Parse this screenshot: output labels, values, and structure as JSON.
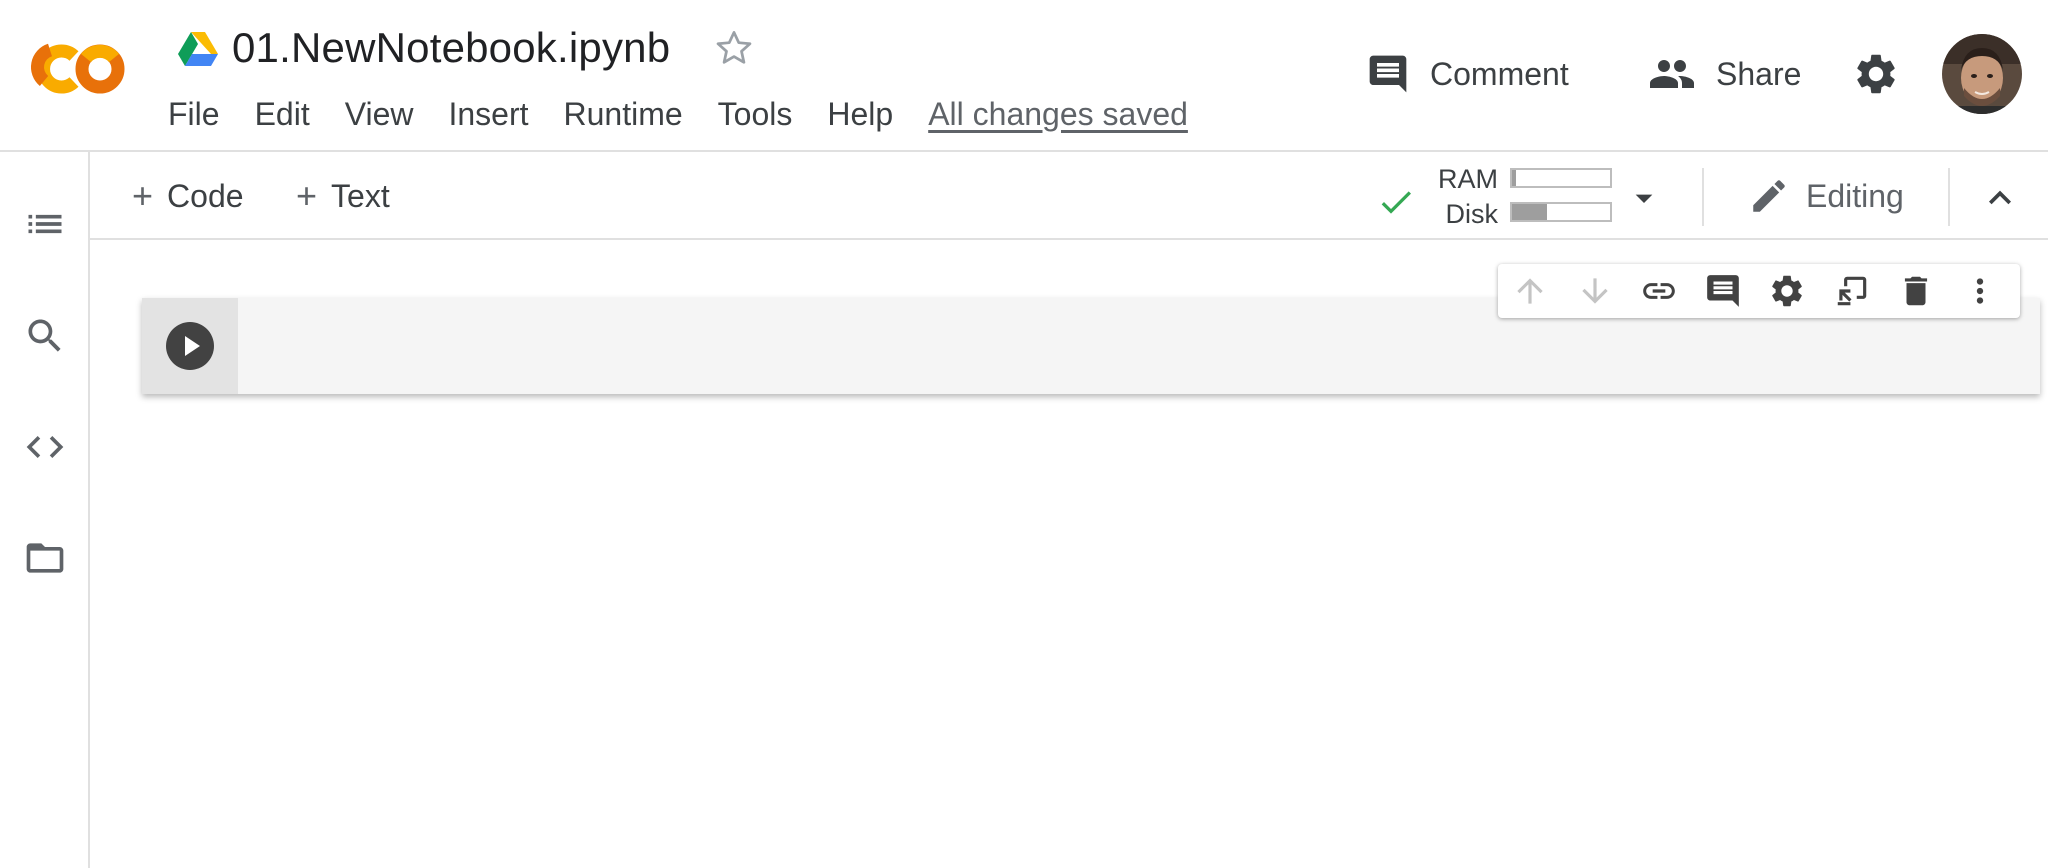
{
  "app": {
    "notebook_title": "01.NewNotebook.ipynb",
    "brand_colors": {
      "logo_orange": "#e8710a",
      "logo_yellow": "#f9ab00"
    }
  },
  "menu": {
    "items": [
      "File",
      "Edit",
      "View",
      "Insert",
      "Runtime",
      "Tools",
      "Help"
    ],
    "save_status": "All changes saved"
  },
  "header_actions": {
    "comment_label": "Comment",
    "share_label": "Share",
    "settings_icon": "gear-icon",
    "avatar": "user-avatar"
  },
  "sidebar": {
    "items": [
      {
        "name": "table-of-contents",
        "icon": "list-icon"
      },
      {
        "name": "find",
        "icon": "search-icon"
      },
      {
        "name": "code-snippets",
        "icon": "code-icon"
      },
      {
        "name": "files",
        "icon": "folder-icon"
      }
    ]
  },
  "toolbar": {
    "add_code_label": "Code",
    "add_text_label": "Text",
    "ram_label": "RAM",
    "disk_label": "Disk",
    "ram_usage": 0.04,
    "disk_usage": 0.36,
    "connected_color": "#34a853",
    "editing_label": "Editing"
  },
  "cell": {
    "type": "code",
    "content": "",
    "toolbar_icons": [
      "arrow-up-icon",
      "arrow-down-icon",
      "link-icon",
      "comment-icon",
      "gear-icon",
      "mirror-cell-icon",
      "delete-icon",
      "more-vert-icon"
    ]
  }
}
